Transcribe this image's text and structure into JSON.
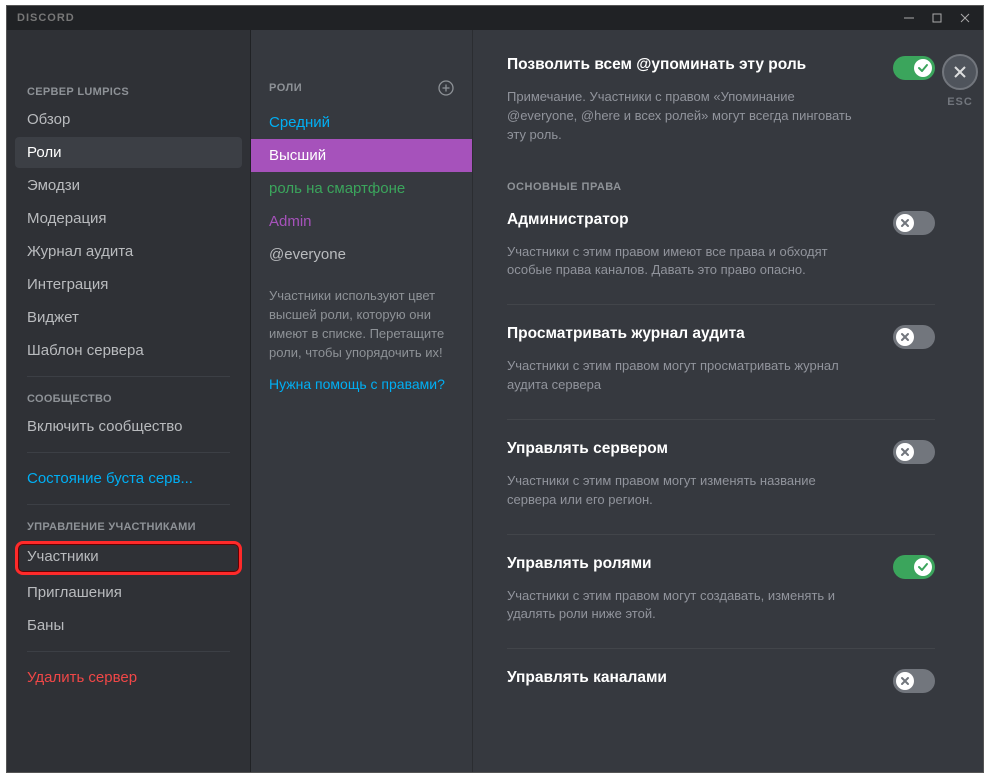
{
  "window": {
    "title": "DISCORD",
    "esc_label": "ESC"
  },
  "sidebar": {
    "server_header": "СЕРВЕР LUMPICS",
    "items_main": [
      "Обзор",
      "Роли",
      "Эмодзи",
      "Модерация",
      "Журнал аудита",
      "Интеграция",
      "Виджет",
      "Шаблон сервера"
    ],
    "community_header": "СООБЩЕСТВО",
    "community_enable": "Включить сообщество",
    "boost_status": "Состояние буста серв...",
    "members_header": "УПРАВЛЕНИЕ УЧАСТНИКАМИ",
    "members_items": [
      "Участники",
      "Приглашения",
      "Баны"
    ],
    "delete_server": "Удалить сервер"
  },
  "roles": {
    "header": "РОЛИ",
    "list": [
      {
        "label": "Средний",
        "color": "#00aff4"
      },
      {
        "label": "Высший",
        "color": "#ffffff",
        "selected": true
      },
      {
        "label": "роль на смартфоне",
        "color": "#3ba55c"
      },
      {
        "label": "Admin",
        "color": "#a652bb"
      },
      {
        "label": "@everyone",
        "color": "#b9bbbe"
      }
    ],
    "hint": "Участники используют цвет высшей роли, которую они имеют в списке. Перетащите роли, чтобы упорядочить их!",
    "help": "Нужна помощь с правами?"
  },
  "permissions": {
    "allow_mention": {
      "title": "Позволить всем @упоминать эту роль",
      "note": "Примечание. Участники с правом «Упоминание @everyone, @here и всех ролей» могут всегда пинговать эту роль.",
      "on": true
    },
    "section_general": "ОСНОВНЫЕ ПРАВА",
    "admin": {
      "title": "Администратор",
      "note": "Участники с этим правом имеют все права и обходят особые права каналов. Давать это право опасно.",
      "on": false
    },
    "audit": {
      "title": "Просматривать журнал аудита",
      "note": "Участники с этим правом могут просматривать журнал аудита сервера",
      "on": false
    },
    "manage_server": {
      "title": "Управлять сервером",
      "note": "Участники с этим правом могут изменять название сервера или его регион.",
      "on": false
    },
    "manage_roles": {
      "title": "Управлять ролями",
      "note": "Участники с этим правом могут создавать, изменять и удалять роли ниже этой.",
      "on": true
    },
    "manage_channels": {
      "title": "Управлять каналами",
      "on": false
    }
  }
}
